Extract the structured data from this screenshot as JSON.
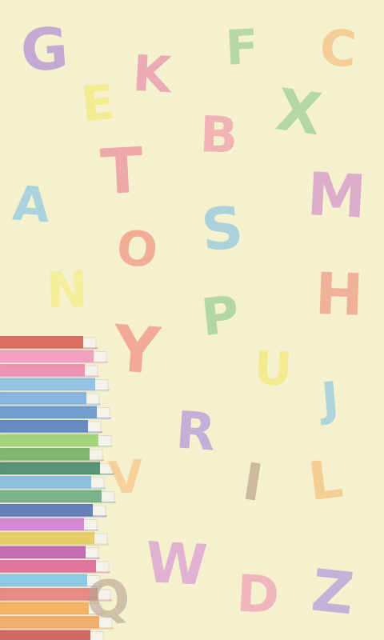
{
  "letters": [
    {
      "char": "G",
      "color": "#a47fd6"
    },
    {
      "char": "K",
      "color": "#e77fa5"
    },
    {
      "char": "F",
      "color": "#8fca8a"
    },
    {
      "char": "C",
      "color": "#f5b874"
    },
    {
      "char": "E",
      "color": "#f2e86a"
    },
    {
      "char": "B",
      "color": "#ef8fa4"
    },
    {
      "char": "X",
      "color": "#8cc98b"
    },
    {
      "char": "T",
      "color": "#ec7d93"
    },
    {
      "char": "A",
      "color": "#7fc1e3"
    },
    {
      "char": "M",
      "color": "#cc85c9"
    },
    {
      "char": "S",
      "color": "#7ebfe2"
    },
    {
      "char": "O",
      "color": "#ef8572"
    },
    {
      "char": "N",
      "color": "#f4ec7a"
    },
    {
      "char": "H",
      "color": "#ef8b78"
    },
    {
      "char": "P",
      "color": "#89c98b"
    },
    {
      "char": "Y",
      "color": "#ef8072"
    },
    {
      "char": "U",
      "color": "#f2e569"
    },
    {
      "char": "J",
      "color": "#82c3de"
    },
    {
      "char": "R",
      "color": "#a988db"
    },
    {
      "char": "V",
      "color": "#f5bf79"
    },
    {
      "char": "I",
      "color": "#b29a82"
    },
    {
      "char": "L",
      "color": "#f5ba70"
    },
    {
      "char": "W",
      "color": "#d48ad2"
    },
    {
      "char": "Q",
      "color": "#b7a58f"
    },
    {
      "char": "D",
      "color": "#ec93b4"
    },
    {
      "char": "Z",
      "color": "#a68ddd"
    }
  ],
  "book_colors": [
    "#d24c3f",
    "#ee8bb5",
    "#ea7aa4",
    "#7ab6df",
    "#6aa5db",
    "#4e86c6",
    "#3f6fb5",
    "#8fcc5c",
    "#62a64c",
    "#2c7a55",
    "#6cb1d9",
    "#59a16e",
    "#3b62ad",
    "#c96bcc",
    "#e1c345",
    "#b548a2",
    "#df5289",
    "#6fbee0",
    "#e56d68",
    "#f2a142",
    "#ef9a45",
    "#c3443d"
  ]
}
